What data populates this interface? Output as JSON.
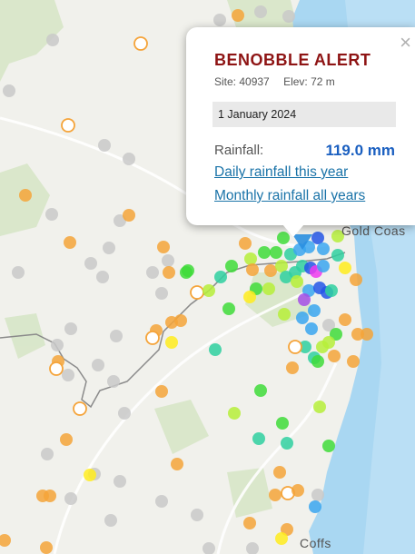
{
  "popup": {
    "title": "BENOBBLE ALERT",
    "site": "Site: 40937",
    "elev": "Elev: 72 m",
    "date": "1 January 2024",
    "rainfall_label": "Rainfall:",
    "rainfall_value": "119.0 mm",
    "daily_link": "Daily rainfall this year",
    "monthly_link": "Monthly rainfall all years",
    "close_glyph": "×"
  },
  "map": {
    "place_labels": {
      "gold_coast": "Gold Coas",
      "coffs": "Coffs"
    },
    "colors": {
      "land": "#f1f1ec",
      "ocean": "#a9d7f2",
      "forest": "#d6e6c6",
      "border": "#8a8a8a",
      "road": "#ffffff"
    }
  }
}
